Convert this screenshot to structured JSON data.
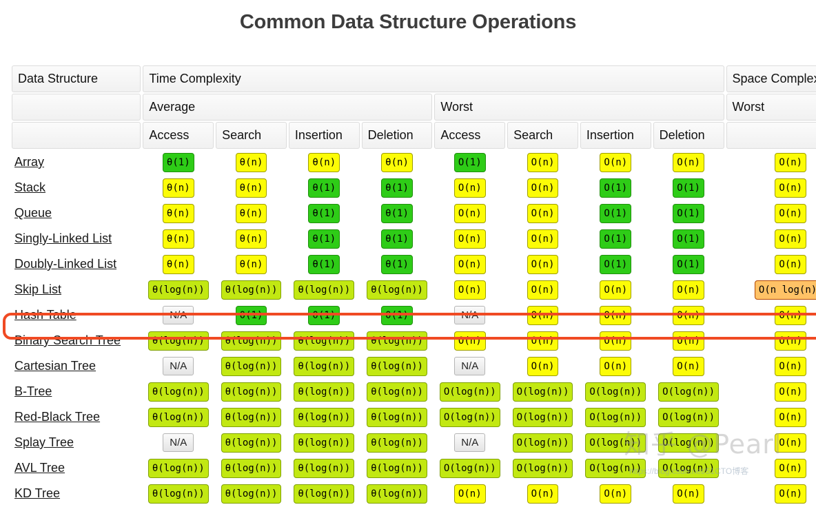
{
  "page": {
    "title": "Common Data Structure Operations"
  },
  "table": {
    "header": {
      "data_structure": "Data Structure",
      "time_complexity": "Time Complexity",
      "space_complexity": "Space Complexity",
      "average": "Average",
      "worst_time": "Worst",
      "worst_space": "Worst",
      "ops": [
        "Access",
        "Search",
        "Insertion",
        "Deletion"
      ],
      "ops_worst": [
        "Access",
        "Search",
        "Insertion",
        "Deletion"
      ]
    },
    "rows": [
      {
        "name": "Array",
        "link": true,
        "avg": [
          "θ(1)",
          "θ(n)",
          "θ(n)",
          "θ(n)"
        ],
        "avg_class": [
          "const",
          "linear",
          "linear",
          "linear"
        ],
        "worst": [
          "O(1)",
          "O(n)",
          "O(n)",
          "O(n)"
        ],
        "worst_class": [
          "const",
          "linear",
          "linear",
          "linear"
        ],
        "space": "O(n)",
        "space_class": "linear"
      },
      {
        "name": "Stack",
        "link": true,
        "avg": [
          "θ(n)",
          "θ(n)",
          "θ(1)",
          "θ(1)"
        ],
        "avg_class": [
          "linear",
          "linear",
          "const",
          "const"
        ],
        "worst": [
          "O(n)",
          "O(n)",
          "O(1)",
          "O(1)"
        ],
        "worst_class": [
          "linear",
          "linear",
          "const",
          "const"
        ],
        "space": "O(n)",
        "space_class": "linear"
      },
      {
        "name": "Queue",
        "link": true,
        "avg": [
          "θ(n)",
          "θ(n)",
          "θ(1)",
          "θ(1)"
        ],
        "avg_class": [
          "linear",
          "linear",
          "const",
          "const"
        ],
        "worst": [
          "O(n)",
          "O(n)",
          "O(1)",
          "O(1)"
        ],
        "worst_class": [
          "linear",
          "linear",
          "const",
          "const"
        ],
        "space": "O(n)",
        "space_class": "linear"
      },
      {
        "name": "Singly-Linked List",
        "link": true,
        "avg": [
          "θ(n)",
          "θ(n)",
          "θ(1)",
          "θ(1)"
        ],
        "avg_class": [
          "linear",
          "linear",
          "const",
          "const"
        ],
        "worst": [
          "O(n)",
          "O(n)",
          "O(1)",
          "O(1)"
        ],
        "worst_class": [
          "linear",
          "linear",
          "const",
          "const"
        ],
        "space": "O(n)",
        "space_class": "linear"
      },
      {
        "name": "Doubly-Linked List",
        "link": true,
        "avg": [
          "θ(n)",
          "θ(n)",
          "θ(1)",
          "θ(1)"
        ],
        "avg_class": [
          "linear",
          "linear",
          "const",
          "const"
        ],
        "worst": [
          "O(n)",
          "O(n)",
          "O(1)",
          "O(1)"
        ],
        "worst_class": [
          "linear",
          "linear",
          "const",
          "const"
        ],
        "space": "O(n)",
        "space_class": "linear"
      },
      {
        "name": "Skip List",
        "link": true,
        "avg": [
          "θ(log(n))",
          "θ(log(n))",
          "θ(log(n))",
          "θ(log(n))"
        ],
        "avg_class": [
          "logn",
          "logn",
          "logn",
          "logn"
        ],
        "worst": [
          "O(n)",
          "O(n)",
          "O(n)",
          "O(n)"
        ],
        "worst_class": [
          "linear",
          "linear",
          "linear",
          "linear"
        ],
        "space": "O(n log(n))",
        "space_class": "nlogn"
      },
      {
        "name": "Hash Table",
        "link": true,
        "highlighted": true,
        "avg": [
          "N/A",
          "θ(1)",
          "θ(1)",
          "θ(1)"
        ],
        "avg_class": [
          "na",
          "const",
          "const",
          "const"
        ],
        "worst": [
          "N/A",
          "O(n)",
          "O(n)",
          "O(n)"
        ],
        "worst_class": [
          "na",
          "linear",
          "linear",
          "linear"
        ],
        "space": "O(n)",
        "space_class": "linear"
      },
      {
        "name": "Binary Search Tree",
        "link": true,
        "avg": [
          "θ(log(n))",
          "θ(log(n))",
          "θ(log(n))",
          "θ(log(n))"
        ],
        "avg_class": [
          "logn",
          "logn",
          "logn",
          "logn"
        ],
        "worst": [
          "O(n)",
          "O(n)",
          "O(n)",
          "O(n)"
        ],
        "worst_class": [
          "linear",
          "linear",
          "linear",
          "linear"
        ],
        "space": "O(n)",
        "space_class": "linear"
      },
      {
        "name": "Cartesian Tree",
        "link": true,
        "avg": [
          "N/A",
          "θ(log(n))",
          "θ(log(n))",
          "θ(log(n))"
        ],
        "avg_class": [
          "na",
          "logn",
          "logn",
          "logn"
        ],
        "worst": [
          "N/A",
          "O(n)",
          "O(n)",
          "O(n)"
        ],
        "worst_class": [
          "na",
          "linear",
          "linear",
          "linear"
        ],
        "space": "O(n)",
        "space_class": "linear"
      },
      {
        "name": "B-Tree",
        "link": true,
        "avg": [
          "θ(log(n))",
          "θ(log(n))",
          "θ(log(n))",
          "θ(log(n))"
        ],
        "avg_class": [
          "logn",
          "logn",
          "logn",
          "logn"
        ],
        "worst": [
          "O(log(n))",
          "O(log(n))",
          "O(log(n))",
          "O(log(n))"
        ],
        "worst_class": [
          "logn",
          "logn",
          "logn",
          "logn"
        ],
        "space": "O(n)",
        "space_class": "linear"
      },
      {
        "name": "Red-Black Tree",
        "link": true,
        "avg": [
          "θ(log(n))",
          "θ(log(n))",
          "θ(log(n))",
          "θ(log(n))"
        ],
        "avg_class": [
          "logn",
          "logn",
          "logn",
          "logn"
        ],
        "worst": [
          "O(log(n))",
          "O(log(n))",
          "O(log(n))",
          "O(log(n))"
        ],
        "worst_class": [
          "logn",
          "logn",
          "logn",
          "logn"
        ],
        "space": "O(n)",
        "space_class": "linear"
      },
      {
        "name": "Splay Tree",
        "link": true,
        "avg": [
          "N/A",
          "θ(log(n))",
          "θ(log(n))",
          "θ(log(n))"
        ],
        "avg_class": [
          "na",
          "logn",
          "logn",
          "logn"
        ],
        "worst": [
          "N/A",
          "O(log(n))",
          "O(log(n))",
          "O(log(n))"
        ],
        "worst_class": [
          "na",
          "logn",
          "logn",
          "logn"
        ],
        "space": "O(n)",
        "space_class": "linear"
      },
      {
        "name": "AVL Tree",
        "link": true,
        "avg": [
          "θ(log(n))",
          "θ(log(n))",
          "θ(log(n))",
          "θ(log(n))"
        ],
        "avg_class": [
          "logn",
          "logn",
          "logn",
          "logn"
        ],
        "worst": [
          "O(log(n))",
          "O(log(n))",
          "O(log(n))",
          "O(log(n))"
        ],
        "worst_class": [
          "logn",
          "logn",
          "logn",
          "logn"
        ],
        "space": "O(n)",
        "space_class": "linear"
      },
      {
        "name": "KD Tree",
        "link": true,
        "avg": [
          "θ(log(n))",
          "θ(log(n))",
          "θ(log(n))",
          "θ(log(n))"
        ],
        "avg_class": [
          "logn",
          "logn",
          "logn",
          "logn"
        ],
        "worst": [
          "O(n)",
          "O(n)",
          "O(n)",
          "O(n)"
        ],
        "worst_class": [
          "linear",
          "linear",
          "linear",
          "linear"
        ],
        "space": "O(n)",
        "space_class": "linear"
      }
    ]
  },
  "highlight": {
    "color": "#f04a23",
    "row_name": "Hash Table"
  },
  "watermark": {
    "main": "知乎 @Pearl",
    "url": "https://blog.csdn.net/51CTO博客"
  },
  "colors": {
    "constant": "#2ecc17",
    "logarithmic": "#c2e812",
    "linear": "#fcfc06",
    "nlogn": "#ffc266",
    "na": "#e4e4e4",
    "title": "#3d3d3d",
    "highlight": "#f04a23"
  }
}
